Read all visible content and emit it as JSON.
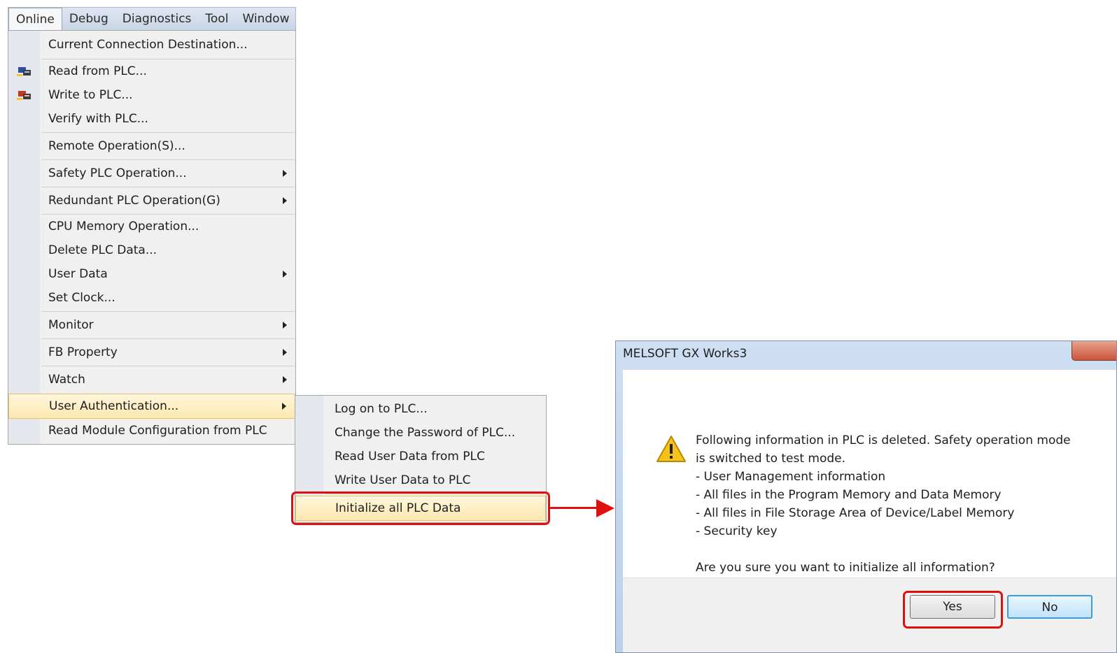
{
  "menubar": {
    "tabs": [
      "Online",
      "Debug",
      "Diagnostics",
      "Tool",
      "Window"
    ],
    "active": "Online"
  },
  "online_menu": {
    "items": [
      {
        "label": "Current Connection Destination...",
        "submenu": false,
        "icon": ""
      },
      {
        "label": "Read from PLC...",
        "submenu": false,
        "icon": "read-from-plc-icon"
      },
      {
        "label": "Write to PLC...",
        "submenu": false,
        "icon": "write-to-plc-icon"
      },
      {
        "label": "Verify with PLC...",
        "submenu": false,
        "icon": ""
      },
      {
        "label": "Remote Operation(S)...",
        "submenu": false,
        "icon": ""
      },
      {
        "label": "Safety PLC Operation...",
        "submenu": true,
        "icon": ""
      },
      {
        "label": "Redundant PLC Operation(G)",
        "submenu": true,
        "icon": ""
      },
      {
        "label": "CPU Memory Operation...",
        "submenu": false,
        "icon": ""
      },
      {
        "label": "Delete PLC Data...",
        "submenu": false,
        "icon": ""
      },
      {
        "label": "User Data",
        "submenu": true,
        "icon": ""
      },
      {
        "label": "Set Clock...",
        "submenu": false,
        "icon": ""
      },
      {
        "label": "Monitor",
        "submenu": true,
        "icon": ""
      },
      {
        "label": "FB Property",
        "submenu": true,
        "icon": ""
      },
      {
        "label": "Watch",
        "submenu": true,
        "icon": ""
      },
      {
        "label": "User Authentication...",
        "submenu": true,
        "icon": "",
        "highlighted": true
      },
      {
        "label": "Read Module Configuration from PLC",
        "submenu": false,
        "icon": ""
      }
    ]
  },
  "user_auth_submenu": {
    "items": [
      {
        "label": "Log on to PLC..."
      },
      {
        "label": "Change the Password of PLC..."
      },
      {
        "label": "Read User Data from PLC"
      },
      {
        "label": "Write User Data to PLC"
      },
      {
        "label": "Initialize all PLC Data",
        "highlighted": true
      }
    ]
  },
  "dialog": {
    "title": "MELSOFT GX Works3",
    "icon": "warning-icon",
    "lines": [
      "Following information in PLC is deleted. Safety operation mode",
      "is switched to test mode.",
      "- User Management information",
      "- All files in the Program Memory and Data Memory",
      "- All files in File Storage Area of Device/Label Memory",
      "- Security key"
    ],
    "question": "Are you sure you want to initialize all information?",
    "buttons": {
      "yes": "Yes",
      "no": "No"
    }
  },
  "colors": {
    "callout": "#e01010",
    "highlight": "#fce8b0",
    "menu_bg": "#f0f0f0"
  }
}
